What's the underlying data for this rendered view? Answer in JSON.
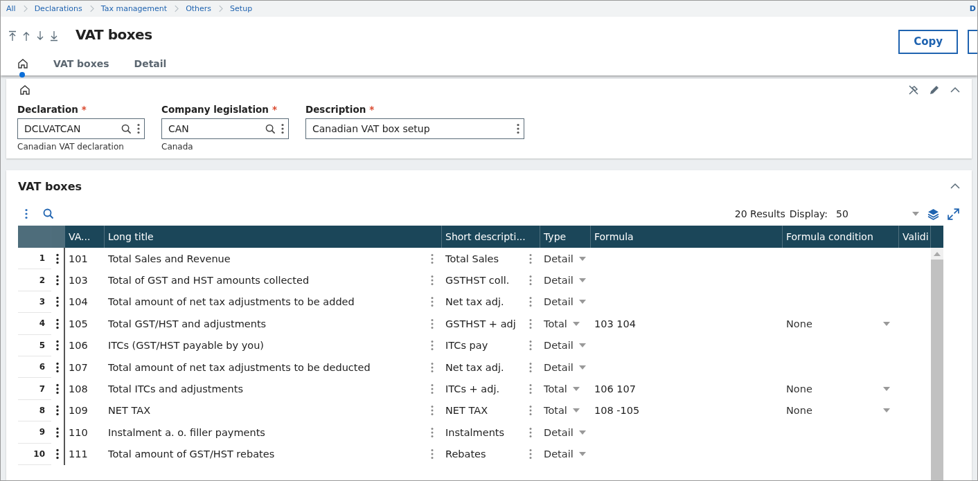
{
  "breadcrumb": [
    "All",
    "Declarations",
    "Tax management",
    "Others",
    "Setup"
  ],
  "corner_text": "D",
  "header": {
    "title": "VAT boxes",
    "actions": [
      "Copy"
    ]
  },
  "tabs": [
    {
      "kind": "home",
      "selected": true
    },
    {
      "kind": "text",
      "label": "VAT boxes",
      "selected": false
    },
    {
      "kind": "text",
      "label": "Detail",
      "selected": false
    }
  ],
  "fields": [
    {
      "label": "Declaration",
      "required_mark": "*",
      "value": "DCLVATCAN",
      "lookup": true,
      "subtitle": "Canadian VAT declaration"
    },
    {
      "label": "Company legislation",
      "required_mark": "*",
      "value": "CAN",
      "lookup": true,
      "subtitle": "Canada"
    },
    {
      "label": "Description",
      "required_mark": "*",
      "value": "Canadian VAT box setup",
      "lookup": false
    }
  ],
  "grid": {
    "title": "VAT boxes",
    "results": "20 Results",
    "display_label": "Display:",
    "display_value": "50",
    "columns": [
      "VA...",
      "Long title",
      "Short descripti...",
      "Type",
      "Formula",
      "Formula condition",
      "Validi"
    ],
    "rows": [
      {
        "num": "1",
        "code": "101",
        "long_title": "Total Sales and Revenue",
        "short": "Total Sales",
        "type": "Detail"
      },
      {
        "num": "2",
        "code": "103",
        "long_title": "Total of GST and HST amounts collected",
        "short": "GSTHST coll.",
        "type": "Detail"
      },
      {
        "num": "3",
        "code": "104",
        "long_title": "Total amount of net tax adjustments to be added",
        "short": "Net tax adj.",
        "type": "Detail"
      },
      {
        "num": "4",
        "code": "105",
        "long_title": "Total GST/HST and adjustments",
        "short": "GSTHST + adj",
        "type": "Total",
        "formula": "103 104",
        "condition": "None"
      },
      {
        "num": "5",
        "code": "106",
        "long_title": "ITCs (GST/HST payable by you)",
        "short": "ITCs pay",
        "type": "Detail"
      },
      {
        "num": "6",
        "code": "107",
        "long_title": "Total amount of net tax adjustments to be deducted",
        "short": "Net tax adj.",
        "type": "Detail"
      },
      {
        "num": "7",
        "code": "108",
        "long_title": "Total ITCs and adjustments",
        "short": "ITCs + adj.",
        "type": "Total",
        "formula": "106 107",
        "condition": "None"
      },
      {
        "num": "8",
        "code": "109",
        "long_title": "NET TAX",
        "short": "NET TAX",
        "type": "Total",
        "formula": "108 -105",
        "condition": "None"
      },
      {
        "num": "9",
        "code": "110",
        "long_title": "Instalment a. o. filler payments",
        "short": "Instalments",
        "type": "Detail"
      },
      {
        "num": "10",
        "code": "111",
        "long_title": "Total amount of GST/HST rebates",
        "short": "Rebates",
        "type": "Detail"
      }
    ]
  }
}
